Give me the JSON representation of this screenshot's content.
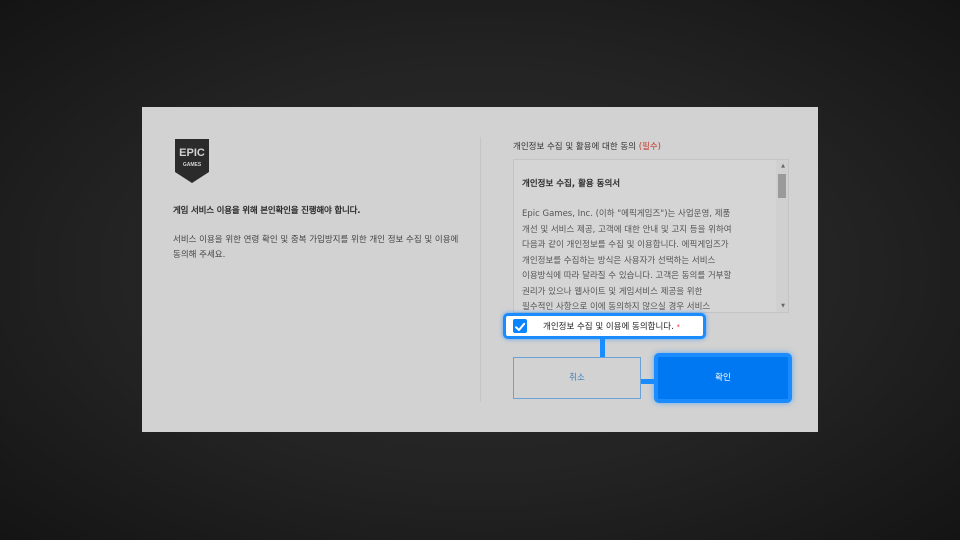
{
  "dialog": {
    "logo_text_top": "EPIC",
    "logo_text_bottom": "GAMES",
    "heading": "게임 서비스 이용을 위해 본인확인을 진행해야 합니다.",
    "description": "서비스 이용을 위한 연령 확인 및 중복 가입방지를 위한 개인 정보 수집 및 이용에 동의해 주세요."
  },
  "consent": {
    "title": "개인정보 수집 및 활용에 대한 동의 ",
    "required_tag": "(필수)",
    "terms_heading": "개인정보 수집, 활용 동의서",
    "terms_lines": [
      "Epic Games, Inc. (이하 \"에픽게임즈\")는 사업운영, 제품",
      "개선 및 서비스 제공, 고객에 대한 안내 및 고지 등을 위하여",
      "다음과 같이 개인정보를 수집 및 이용합니다. 에픽게임즈가",
      "개인정보를 수집하는 방식은 사용자가 선택하는 서비스",
      "이용방식에 따라 달라질 수 있습니다. 고객은 동의를 거부할",
      "권리가 있으나 웹사이트 및 게임서비스 제공을 위한",
      "필수적인 사항으로 이에 동의하지 않으실 경우 서비스"
    ],
    "checkbox_label": "개인정보 수집 및 이용에 동의합니다.",
    "checkbox_required_mark": "*"
  },
  "buttons": {
    "cancel": "취소",
    "confirm": "확인"
  },
  "colors": {
    "accent": "#1a8cff",
    "confirm_bg": "#0078f2",
    "required": "#c0392b"
  }
}
